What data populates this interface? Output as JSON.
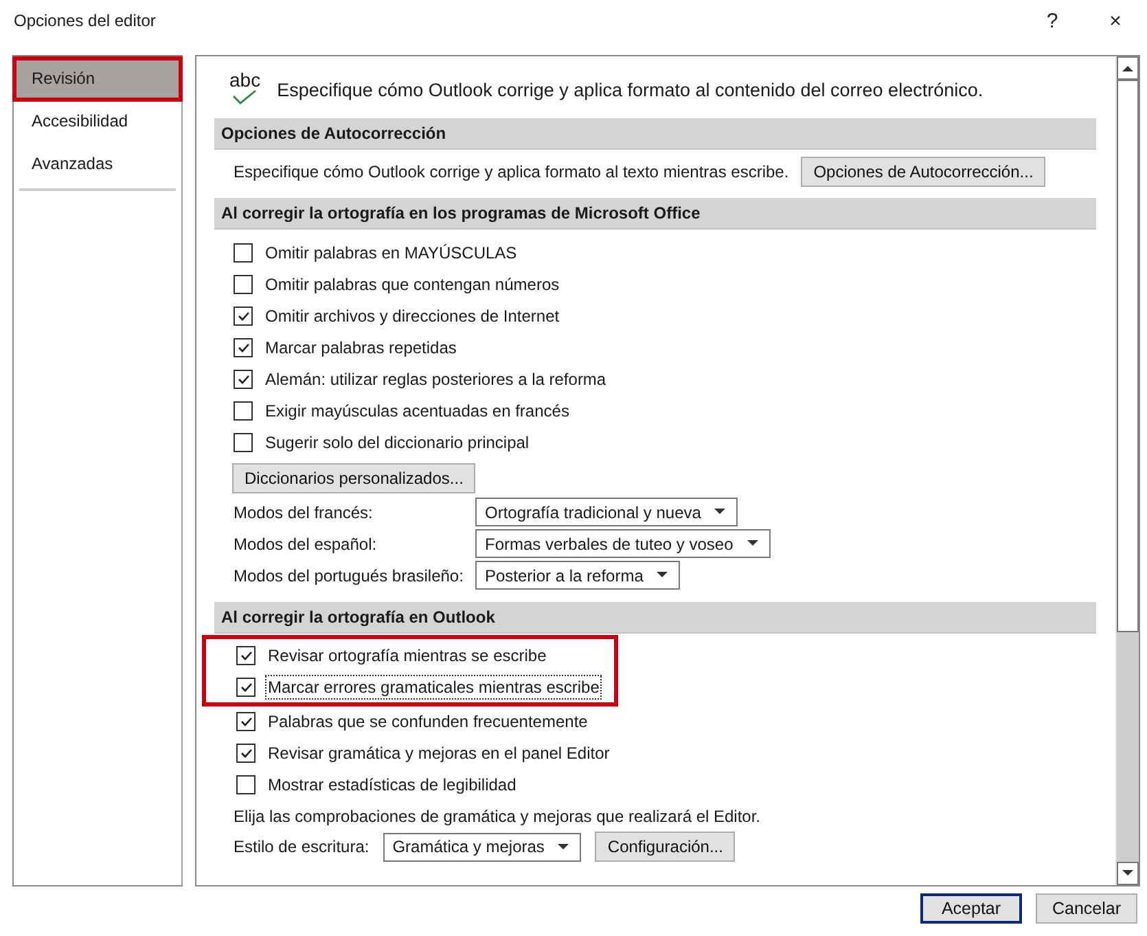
{
  "window": {
    "title": "Opciones del editor",
    "help": "?",
    "close": "×"
  },
  "sidebar": {
    "items": [
      {
        "label": "Revisión",
        "selected": true,
        "highlighted": true
      },
      {
        "label": "Accesibilidad",
        "selected": false,
        "highlighted": false
      },
      {
        "label": "Avanzadas",
        "selected": false,
        "highlighted": false
      }
    ]
  },
  "intro": {
    "icon_text": "abc",
    "text": "Especifique cómo Outlook corrige y aplica formato al contenido del correo electrónico."
  },
  "autocorrect": {
    "heading": "Opciones de Autocorrección",
    "text": "Especifique cómo Outlook corrige y aplica formato al texto mientras escribe.",
    "button": "Opciones de Autocorrección..."
  },
  "office": {
    "heading": "Al corregir la ortografía en los programas de Microsoft Office",
    "options": [
      {
        "label": "Omitir palabras en MAYÚSCULAS",
        "checked": false
      },
      {
        "label": "Omitir palabras que contengan números",
        "checked": false
      },
      {
        "label": "Omitir archivos y direcciones de Internet",
        "checked": true
      },
      {
        "label": "Marcar palabras repetidas",
        "checked": true
      },
      {
        "label": "Alemán: utilizar reglas posteriores a la reforma",
        "checked": true
      },
      {
        "label": "Exigir mayúsculas acentuadas en francés",
        "checked": false
      },
      {
        "label": "Sugerir solo del diccionario principal",
        "checked": false
      }
    ],
    "button": "Diccionarios personalizados...",
    "modes": [
      {
        "label": "Modos del francés:",
        "value": "Ortografía tradicional y nueva"
      },
      {
        "label": "Modos del español:",
        "value": "Formas verbales de tuteo y voseo"
      },
      {
        "label": "Modos del portugués brasileño:",
        "value": "Posterior a la reforma"
      }
    ]
  },
  "outlook": {
    "heading": "Al corregir la ortografía en Outlook",
    "groups": [
      {
        "highlighted": true,
        "options": [
          {
            "label": "Revisar ortografía mientras se escribe",
            "checked": true,
            "focused": false
          },
          {
            "label": "Marcar errores gramaticales mientras escribe",
            "checked": true,
            "focused": true
          }
        ]
      },
      {
        "highlighted": false,
        "options": [
          {
            "label": "Palabras que se confunden frecuentemente",
            "checked": true,
            "focused": false
          },
          {
            "label": "Revisar gramática y mejoras en el panel Editor",
            "checked": true,
            "focused": false
          },
          {
            "label": "Mostrar estadísticas de legibilidad",
            "checked": false,
            "focused": false
          }
        ]
      }
    ],
    "note": "Elija las comprobaciones de gramática y mejoras que realizará el Editor.",
    "style_label": "Estilo de escritura:",
    "style_value": "Gramática y mejoras",
    "settings_button": "Configuración..."
  },
  "footer": {
    "ok": "Aceptar",
    "cancel": "Cancelar"
  }
}
